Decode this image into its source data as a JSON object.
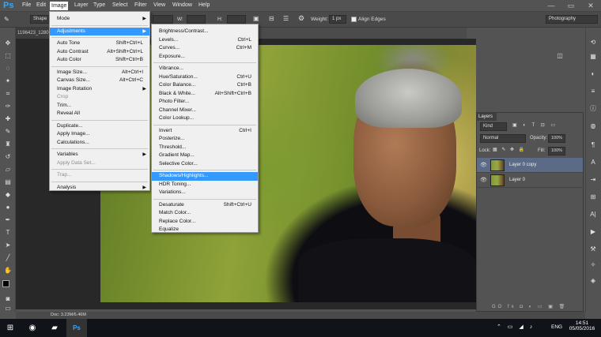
{
  "app": {
    "logo": "Ps"
  },
  "menubar": {
    "items": [
      "File",
      "Edit",
      "Image",
      "Layer",
      "Type",
      "Select",
      "Filter",
      "View",
      "Window",
      "Help"
    ],
    "active": "Image",
    "window_controls": {
      "minimize": "—",
      "restore": "▭",
      "close": "✕"
    }
  },
  "options": {
    "tool_preset": "Shape",
    "weight_label": "Weight:",
    "weight_value": "1 px",
    "align_edges": "Align Edges",
    "workspace": "Photography",
    "w_label": "W:",
    "h_label": "H:"
  },
  "document": {
    "tab": "1196423_1280"
  },
  "image_menu": [
    {
      "label": "Mode",
      "submenu": true
    },
    {
      "sep": true
    },
    {
      "label": "Adjustments",
      "submenu": true,
      "highlighted": true
    },
    {
      "sep": true
    },
    {
      "label": "Auto Tone",
      "shortcut": "Shift+Ctrl+L"
    },
    {
      "label": "Auto Contrast",
      "shortcut": "Alt+Shift+Ctrl+L"
    },
    {
      "label": "Auto Color",
      "shortcut": "Shift+Ctrl+B"
    },
    {
      "sep": true
    },
    {
      "label": "Image Size...",
      "shortcut": "Alt+Ctrl+I"
    },
    {
      "label": "Canvas Size...",
      "shortcut": "Alt+Ctrl+C"
    },
    {
      "label": "Image Rotation",
      "submenu": true
    },
    {
      "label": "Crop",
      "disabled": true
    },
    {
      "label": "Trim..."
    },
    {
      "label": "Reveal All"
    },
    {
      "sep": true
    },
    {
      "label": "Duplicate..."
    },
    {
      "label": "Apply Image..."
    },
    {
      "label": "Calculations..."
    },
    {
      "sep": true
    },
    {
      "label": "Variables",
      "submenu": true
    },
    {
      "label": "Apply Data Set...",
      "disabled": true
    },
    {
      "sep": true
    },
    {
      "label": "Trap...",
      "disabled": true
    },
    {
      "sep": true
    },
    {
      "label": "Analysis",
      "submenu": true
    }
  ],
  "adjustments_menu": [
    {
      "label": "Brightness/Contrast..."
    },
    {
      "label": "Levels...",
      "shortcut": "Ctrl+L"
    },
    {
      "label": "Curves...",
      "shortcut": "Ctrl+M"
    },
    {
      "label": "Exposure..."
    },
    {
      "sep": true
    },
    {
      "label": "Vibrance..."
    },
    {
      "label": "Hue/Saturation...",
      "shortcut": "Ctrl+U"
    },
    {
      "label": "Color Balance...",
      "shortcut": "Ctrl+B"
    },
    {
      "label": "Black & White...",
      "shortcut": "Alt+Shift+Ctrl+B"
    },
    {
      "label": "Photo Filter..."
    },
    {
      "label": "Channel Mixer..."
    },
    {
      "label": "Color Lookup..."
    },
    {
      "sep": true
    },
    {
      "label": "Invert",
      "shortcut": "Ctrl+I"
    },
    {
      "label": "Posterize..."
    },
    {
      "label": "Threshold..."
    },
    {
      "label": "Gradient Map..."
    },
    {
      "label": "Selective Color..."
    },
    {
      "sep": true
    },
    {
      "label": "Shadows/Highlights...",
      "highlighted": true
    },
    {
      "label": "HDR Toning..."
    },
    {
      "label": "Variations..."
    },
    {
      "sep": true
    },
    {
      "label": "Desaturate",
      "shortcut": "Shift+Ctrl+U"
    },
    {
      "label": "Match Color..."
    },
    {
      "label": "Replace Color..."
    },
    {
      "label": "Equalize"
    }
  ],
  "layers_panel": {
    "tab": "Layers",
    "filter": "Kind",
    "blend_mode": "Normal",
    "opacity_label": "Opacity:",
    "opacity": "100%",
    "lock_label": "Lock:",
    "fill_label": "Fill:",
    "fill": "100%",
    "layers": [
      {
        "name": "Layer 0 copy",
        "selected": true
      },
      {
        "name": "Layer 0",
        "selected": false
      }
    ],
    "footer_icons": "GO fx ◘ ◐ ▭ ▣ 🗑"
  },
  "status": {
    "doc": "Doc: 3.23M/6.46M"
  },
  "taskbar": {
    "language": "ENG",
    "time": "14:51",
    "date": "05/05/2016"
  },
  "colors": {
    "highlight": "#3399ff",
    "ps_blue": "#31a8ff",
    "panel_bg": "#535353"
  }
}
